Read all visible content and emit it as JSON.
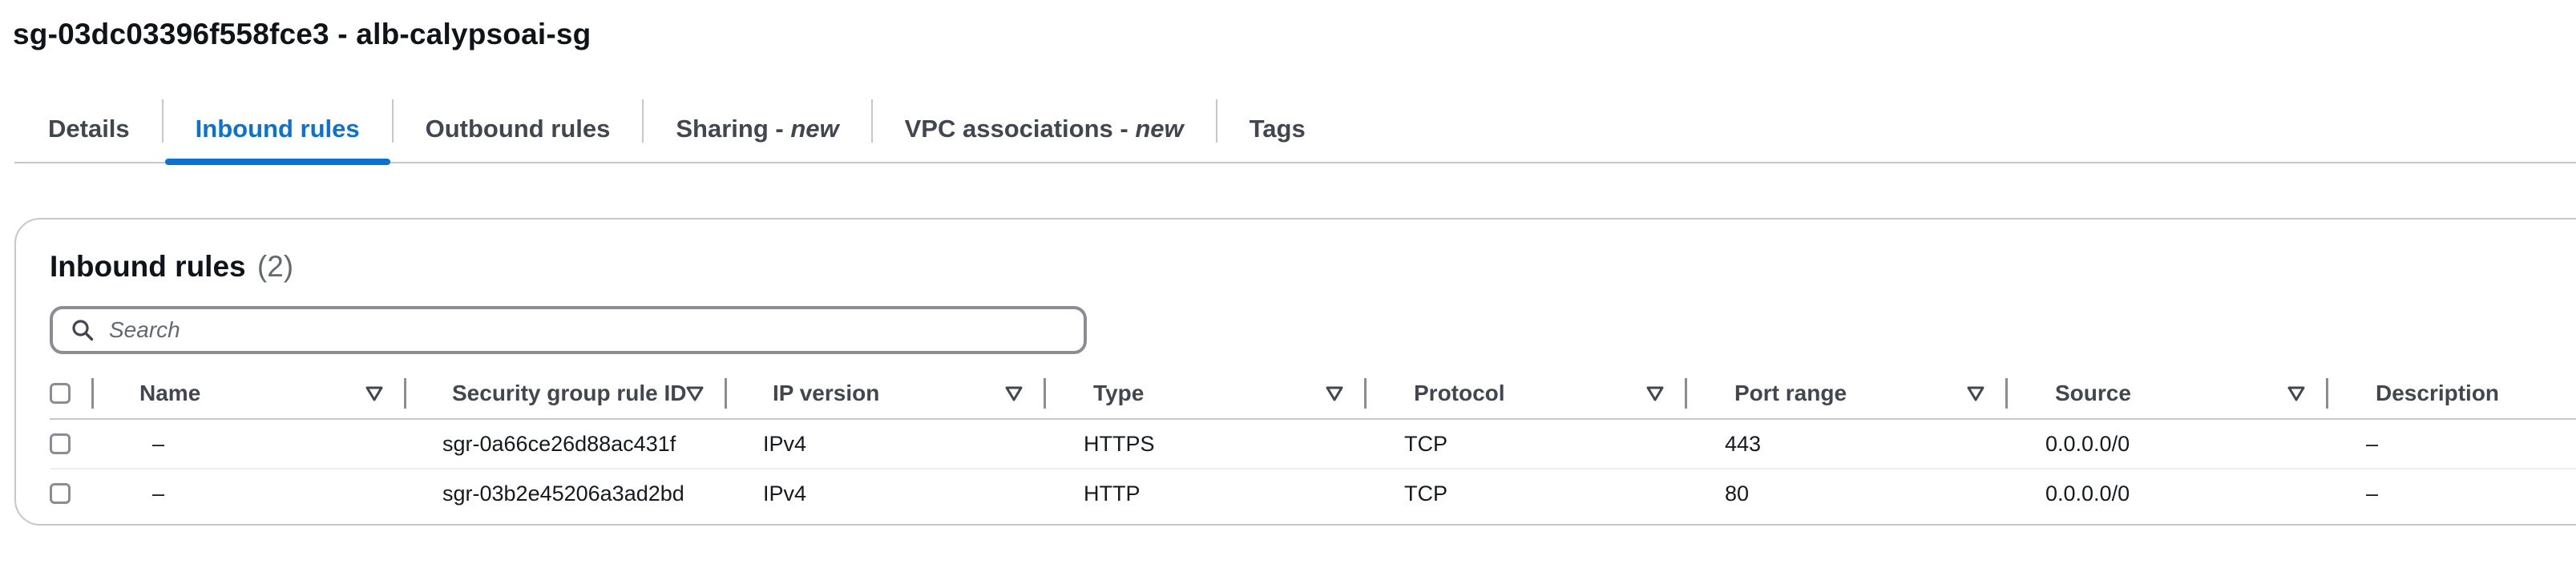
{
  "page_title": "sg-03dc03396f558fce3 - alb-calypsoai-sg",
  "tabs": [
    {
      "label": "Details",
      "suffix": ""
    },
    {
      "label": "Inbound rules",
      "suffix": ""
    },
    {
      "label": "Outbound rules",
      "suffix": ""
    },
    {
      "label": "Sharing - ",
      "suffix": "new"
    },
    {
      "label": "VPC associations - ",
      "suffix": "new"
    },
    {
      "label": "Tags",
      "suffix": ""
    }
  ],
  "active_tab": "Inbound rules",
  "panel": {
    "title": "Inbound rules",
    "count": "(2)"
  },
  "search": {
    "placeholder": "Search",
    "value": ""
  },
  "table": {
    "columns": [
      "Name",
      "Security group rule ID",
      "IP version",
      "Type",
      "Protocol",
      "Port range",
      "Source",
      "Description"
    ],
    "rows": [
      [
        "–",
        "sgr-0a66ce26d88ac431f",
        "IPv4",
        "HTTPS",
        "TCP",
        "443",
        "0.0.0.0/0",
        "–"
      ],
      [
        "–",
        "sgr-03b2e45206a3ad2bd",
        "IPv4",
        "HTTP",
        "TCP",
        "80",
        "0.0.0.0/0",
        "–"
      ]
    ]
  },
  "colors": {
    "accent": "#0972d3",
    "text": "#16191f",
    "muted": "#656871",
    "border": "#c6c6cd"
  },
  "icons": {
    "search": "search-icon",
    "sort": "sort-caret-down-icon"
  }
}
